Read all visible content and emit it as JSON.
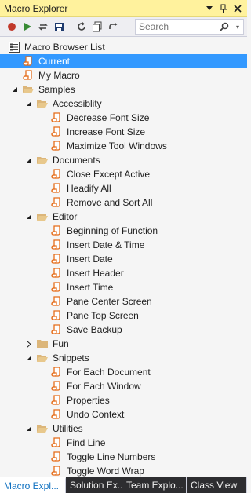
{
  "window": {
    "title": "Macro Explorer",
    "controls": [
      "pin-dropdown-icon",
      "pin-icon",
      "close-icon"
    ]
  },
  "toolbar": {
    "buttons": [
      "record-icon",
      "play-icon",
      "loop-icon",
      "save-icon",
      "refresh-icon",
      "copy-icon",
      "redo-icon"
    ],
    "search_placeholder": "Search"
  },
  "colors": {
    "title_bg": "#fff29d",
    "selection": "#3399ff",
    "macro_icon": "#e56c19",
    "folder": "#dcb67a",
    "record": "#c1392b",
    "play": "#388a34"
  },
  "tree": [
    {
      "label": "Macro Browser List",
      "level": 0,
      "type": "root",
      "arrow": ""
    },
    {
      "label": "Current",
      "level": 1,
      "type": "macro",
      "arrow": "",
      "selected": true
    },
    {
      "label": "My Macro",
      "level": 1,
      "type": "macro",
      "arrow": ""
    },
    {
      "label": "Samples",
      "level": 1,
      "type": "folder-open",
      "arrow": "expanded"
    },
    {
      "label": "Accessiblity",
      "level": 2,
      "type": "folder-open",
      "arrow": "expanded"
    },
    {
      "label": "Decrease Font Size",
      "level": 3,
      "type": "macro",
      "arrow": ""
    },
    {
      "label": "Increase Font Size",
      "level": 3,
      "type": "macro",
      "arrow": ""
    },
    {
      "label": "Maximize Tool Windows",
      "level": 3,
      "type": "macro",
      "arrow": ""
    },
    {
      "label": "Documents",
      "level": 2,
      "type": "folder-open",
      "arrow": "expanded"
    },
    {
      "label": "Close Except Active",
      "level": 3,
      "type": "macro",
      "arrow": ""
    },
    {
      "label": "Headify All",
      "level": 3,
      "type": "macro",
      "arrow": ""
    },
    {
      "label": "Remove and Sort All",
      "level": 3,
      "type": "macro",
      "arrow": ""
    },
    {
      "label": "Editor",
      "level": 2,
      "type": "folder-open",
      "arrow": "expanded"
    },
    {
      "label": "Beginning of Function",
      "level": 3,
      "type": "macro",
      "arrow": ""
    },
    {
      "label": "Insert Date & Time",
      "level": 3,
      "type": "macro",
      "arrow": ""
    },
    {
      "label": "Insert Date",
      "level": 3,
      "type": "macro",
      "arrow": ""
    },
    {
      "label": "Insert Header",
      "level": 3,
      "type": "macro",
      "arrow": ""
    },
    {
      "label": "Insert Time",
      "level": 3,
      "type": "macro",
      "arrow": ""
    },
    {
      "label": "Pane Center Screen",
      "level": 3,
      "type": "macro",
      "arrow": ""
    },
    {
      "label": "Pane Top Screen",
      "level": 3,
      "type": "macro",
      "arrow": ""
    },
    {
      "label": "Save Backup",
      "level": 3,
      "type": "macro",
      "arrow": ""
    },
    {
      "label": "Fun",
      "level": 2,
      "type": "folder-closed",
      "arrow": "collapsed"
    },
    {
      "label": "Snippets",
      "level": 2,
      "type": "folder-open",
      "arrow": "expanded"
    },
    {
      "label": "For Each Document",
      "level": 3,
      "type": "macro",
      "arrow": ""
    },
    {
      "label": "For Each Window",
      "level": 3,
      "type": "macro",
      "arrow": ""
    },
    {
      "label": "Properties",
      "level": 3,
      "type": "macro",
      "arrow": ""
    },
    {
      "label": "Undo Context",
      "level": 3,
      "type": "macro",
      "arrow": ""
    },
    {
      "label": "Utilities",
      "level": 2,
      "type": "folder-open",
      "arrow": "expanded"
    },
    {
      "label": "Find Line",
      "level": 3,
      "type": "macro",
      "arrow": ""
    },
    {
      "label": "Toggle Line Numbers",
      "level": 3,
      "type": "macro",
      "arrow": ""
    },
    {
      "label": "Toggle Word Wrap",
      "level": 3,
      "type": "macro",
      "arrow": ""
    }
  ],
  "tabs": [
    {
      "label": "Macro Expl...",
      "active": true
    },
    {
      "label": "Solution Ex...",
      "active": false
    },
    {
      "label": "Team Explo...",
      "active": false
    },
    {
      "label": "Class View",
      "active": false
    }
  ]
}
